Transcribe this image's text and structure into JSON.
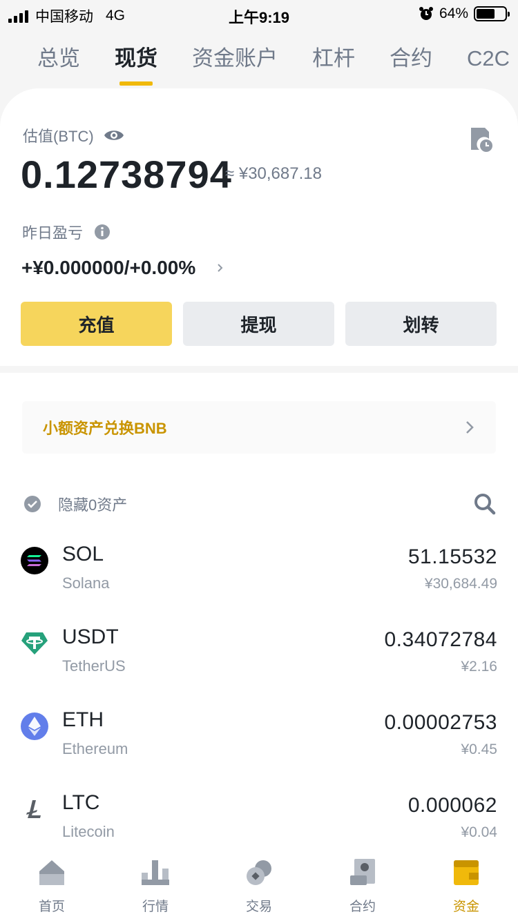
{
  "status_bar": {
    "carrier": "中国移动",
    "network": "4G",
    "time": "上午9:19",
    "battery": "64%",
    "battery_level": 0.64
  },
  "tabs": [
    {
      "label": "总览"
    },
    {
      "label": "现货"
    },
    {
      "label": "资金账户"
    },
    {
      "label": "杠杆"
    },
    {
      "label": "合约"
    },
    {
      "label": "C2C"
    }
  ],
  "summary": {
    "estimate_label": "估值(BTC)",
    "balance_btc": "0.12738794",
    "balance_cny": "≈ ¥30,687.18",
    "pnl_label": "昨日盈亏",
    "pnl_value": "+¥0.000000/+0.00%"
  },
  "actions": {
    "deposit": "充值",
    "withdraw": "提现",
    "transfer": "划转"
  },
  "convert_banner": {
    "label": "小额资产兑换BNB"
  },
  "filter": {
    "hide_label": "隐藏0资产"
  },
  "assets": [
    {
      "symbol": "SOL",
      "name": "Solana",
      "amount": "51.15532",
      "cny": "¥30,684.49",
      "icon": "solana-icon"
    },
    {
      "symbol": "USDT",
      "name": "TetherUS",
      "amount": "0.34072784",
      "cny": "¥2.16",
      "icon": "tether-icon"
    },
    {
      "symbol": "ETH",
      "name": "Ethereum",
      "amount": "0.00002753",
      "cny": "¥0.45",
      "icon": "ethereum-icon"
    },
    {
      "symbol": "LTC",
      "name": "Litecoin",
      "amount": "0.000062",
      "cny": "¥0.04",
      "icon": "litecoin-icon"
    }
  ],
  "bottom_nav": [
    {
      "label": "首页",
      "icon": "home-icon"
    },
    {
      "label": "行情",
      "icon": "markets-icon"
    },
    {
      "label": "交易",
      "icon": "trade-icon"
    },
    {
      "label": "合约",
      "icon": "futures-icon"
    },
    {
      "label": "资金",
      "icon": "wallet-icon"
    }
  ],
  "colors": {
    "accent": "#f0b90b",
    "primary_button": "#f6d55c",
    "convert_text": "#c99400",
    "text_primary": "#1e2329",
    "text_secondary": "#707a8a"
  }
}
